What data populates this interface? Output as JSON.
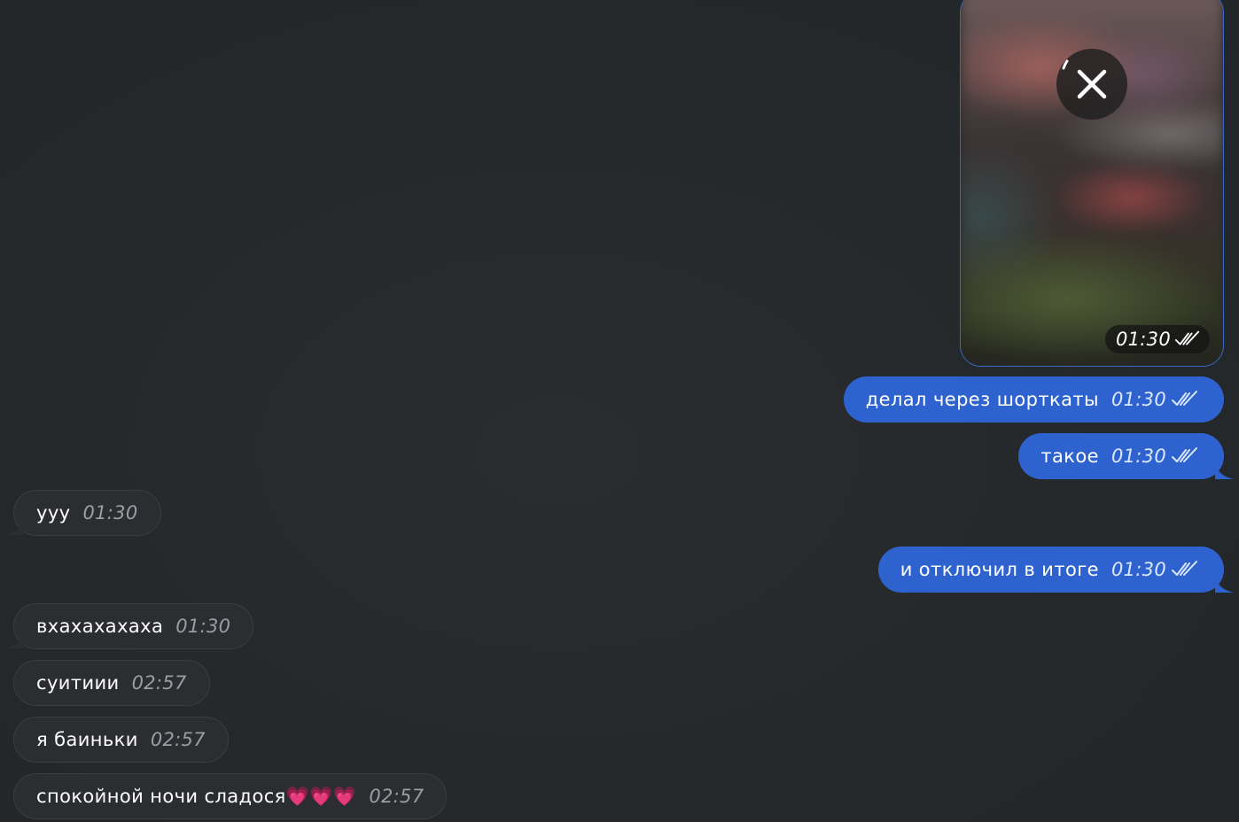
{
  "outgoing": [
    {
      "text": "делал через шорткаты",
      "time": "01:30"
    },
    {
      "text": "такое",
      "time": "01:30"
    },
    {
      "text": "и отключил в итоге",
      "time": "01:30"
    }
  ],
  "media": {
    "time": "01:30",
    "close_icon": "close-icon",
    "status_icon": "double-check-icon"
  },
  "incoming": [
    {
      "text": "ууу",
      "time": "01:30"
    },
    {
      "text": "вхахахахаха",
      "time": "01:30"
    },
    {
      "text": "суитиии",
      "time": "02:57"
    },
    {
      "text": "я баиньки",
      "time": "02:57"
    },
    {
      "text": "спокойной ночи сладося💗💗💗",
      "time": "02:57"
    }
  ],
  "colors": {
    "background": "#25282b",
    "outgoing_bubble": "#2e63cf",
    "incoming_bubble": "#2b2d30"
  }
}
